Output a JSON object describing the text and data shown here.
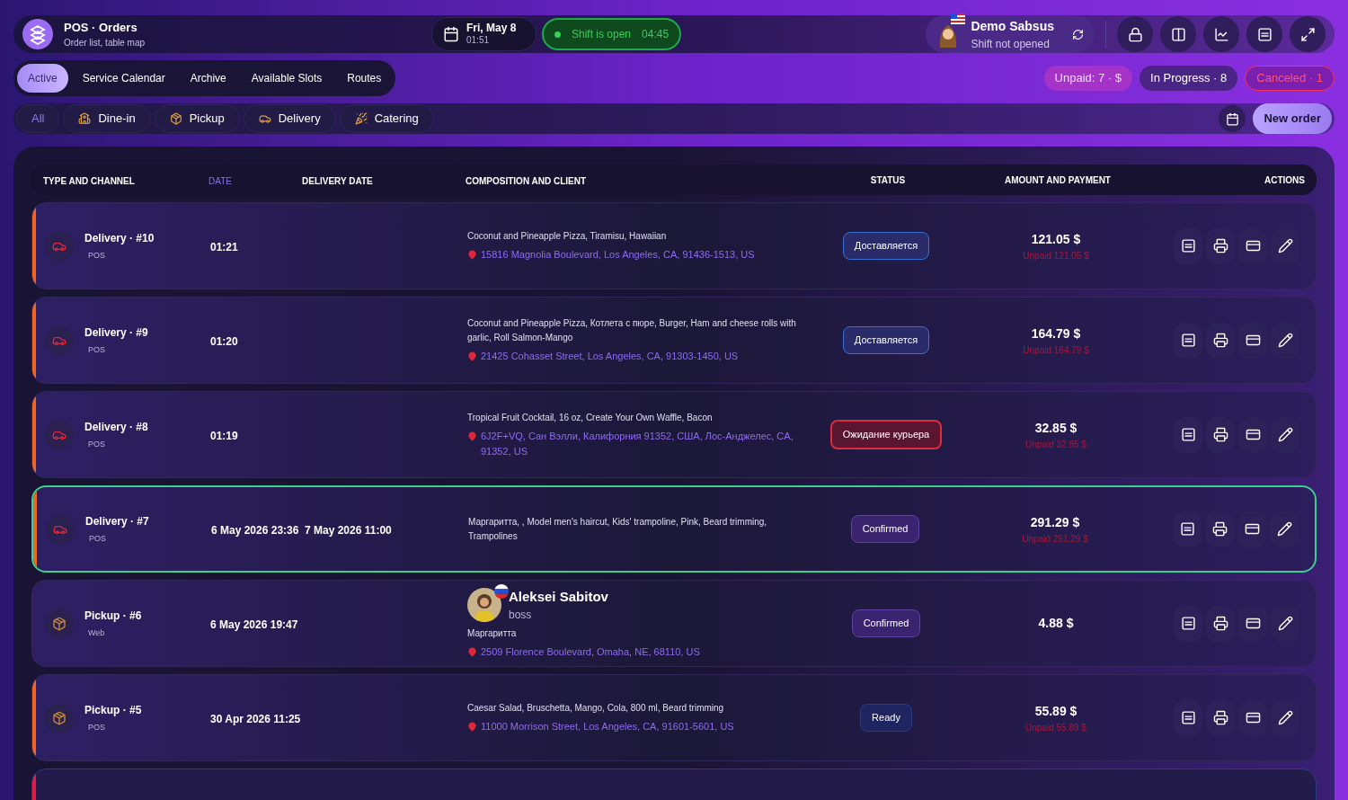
{
  "app": {
    "title": "POS · Orders",
    "subtitle": "Order list, table map"
  },
  "date_widget": {
    "date": "Fri, May 8",
    "time": "01:51"
  },
  "shift": {
    "label": "Shift is open",
    "timer": "04:45",
    "open": true
  },
  "user": {
    "name": "Demo Sabsus",
    "status": "Shift not opened"
  },
  "tabs": [
    {
      "label": "Active",
      "selected": true
    },
    {
      "label": "Service Calendar",
      "selected": false
    },
    {
      "label": "Archive",
      "selected": false
    },
    {
      "label": "Available Slots",
      "selected": false
    },
    {
      "label": "Routes",
      "selected": false
    }
  ],
  "summary_chips": [
    {
      "label": "Unpaid: 7 · $",
      "kind": "unpaid"
    },
    {
      "label": "In Progress · 8",
      "kind": "progress"
    },
    {
      "label": "Canceled · 1",
      "kind": "canceled"
    }
  ],
  "filters": [
    {
      "label": "All",
      "kind": "all",
      "selected": true
    },
    {
      "label": "Dine-in",
      "kind": "dinein",
      "selected": false
    },
    {
      "label": "Pickup",
      "kind": "pickup",
      "selected": false
    },
    {
      "label": "Delivery",
      "kind": "delivery",
      "selected": false
    },
    {
      "label": "Catering",
      "kind": "catering",
      "selected": false
    }
  ],
  "new_order": "New order",
  "table": {
    "columns": [
      {
        "label": "TYPE AND CHANNEL",
        "selected": false
      },
      {
        "label": "DATE",
        "selected": true
      },
      {
        "label": "DELIVERY DATE",
        "selected": false
      },
      {
        "label": "COMPOSITION AND CLIENT",
        "selected": false
      },
      {
        "label": "STATUS",
        "selected": false
      },
      {
        "label": "AMOUNT AND PAYMENT",
        "selected": false
      },
      {
        "label": "ACTIONS",
        "selected": false
      }
    ],
    "rows": [
      {
        "kind": "delivery",
        "type": "Delivery · #10",
        "channel": "POS",
        "color": "#f0651f",
        "selected": false,
        "date": "01:21",
        "items": "Coconut and Pineapple Pizza, Tiramisu, Hawaiian",
        "address": "15816 Magnolia Boulevard, Los Angeles, CA, 91436-1513, US",
        "status": {
          "label": "Доставляется",
          "kind": "delivering"
        },
        "amount": "121.05 $",
        "payment": "Unpaid 121.05 $"
      },
      {
        "kind": "delivery",
        "type": "Delivery · #9",
        "channel": "POS",
        "color": "#f0651f",
        "selected": false,
        "date": "01:20",
        "items": "Coconut and Pineapple Pizza, Котлета с пюре, Burger, Ham and cheese rolls with garlic, Roll Salmon-Mango",
        "address": "21425 Cohasset Street, Los Angeles, CA, 91303-1450, US",
        "status": {
          "label": "Доставляется",
          "kind": "delivering"
        },
        "amount": "164.79 $",
        "payment": "Unpaid 164.79 $"
      },
      {
        "kind": "delivery",
        "type": "Delivery · #8",
        "channel": "POS",
        "color": "#f0651f",
        "selected": false,
        "date": "01:19",
        "items": "Tropical Fruit Cocktail, 16 oz, Create Your Own Waffle, Bacon",
        "address": "6J2F+VQ, Сан Вэлли, Калифорния 91352, США, Лос-Анджелес, CA, 91352, US",
        "status": {
          "label": "Ожидание курьера",
          "kind": "waiting"
        },
        "amount": "32.85 $",
        "payment": "Unpaid 32.85 $"
      },
      {
        "kind": "delivery",
        "type": "Delivery · #7",
        "channel": "POS",
        "color": "#f0651f",
        "selected": true,
        "date": "6 May 2026 23:36",
        "delivery_date": "7 May 2026 11:00",
        "items": "Маргаритта,  , Model men's haircut, Kids' trampoline, Pink, Beard trimming, Trampolines",
        "status": {
          "label": "Confirmed",
          "kind": "confirmed"
        },
        "amount": "291.29 $",
        "payment": "Unpaid 291.29 $"
      },
      {
        "kind": "pickup",
        "type": "Pickup · #6",
        "channel": "Web",
        "selected": false,
        "date": "6 May 2026 19:47",
        "client": {
          "name": "Aleksei Sabitov",
          "role": "boss"
        },
        "items": "Маргаритта",
        "address": "2509 Florence Boulevard, Omaha, NE, 68110, US",
        "status": {
          "label": "Confirmed",
          "kind": "confirmed"
        },
        "amount": "4.88 $"
      },
      {
        "kind": "pickup",
        "type": "Pickup · #5",
        "channel": "POS",
        "color": "#f0651f",
        "selected": false,
        "date": "30 Apr 2026 11:25",
        "items": "Caesar Salad, Bruschetta, Mango, Cola, 800 ml, Beard trimming",
        "address": "11000 Morrison Street, Los Angeles, CA, 91601-5601, US",
        "status": {
          "label": "Ready",
          "kind": "ready"
        },
        "amount": "55.89 $",
        "payment": "Unpaid 55.89 $"
      }
    ],
    "partial_row": {
      "color": "#e11d48"
    }
  }
}
